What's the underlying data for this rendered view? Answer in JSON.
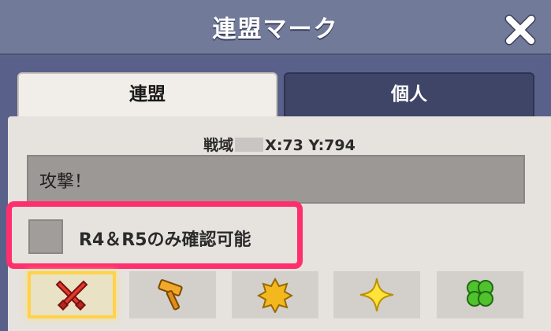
{
  "header": {
    "title": "連盟マーク",
    "close_icon": "close-x-icon"
  },
  "tabs": [
    {
      "label": "連盟",
      "active": true
    },
    {
      "label": "個人",
      "active": false
    }
  ],
  "location": {
    "prefix": "戦域",
    "coords": "X:73  Y:794"
  },
  "message": {
    "value": "攻撃！"
  },
  "restrict": {
    "label": "R4＆R5のみ確認可能",
    "checked": false
  },
  "markers": [
    {
      "icon": "crossed-swords-icon",
      "selected": true
    },
    {
      "icon": "hammer-icon",
      "selected": false
    },
    {
      "icon": "gold-badge-icon",
      "selected": false
    },
    {
      "icon": "star-icon",
      "selected": false
    },
    {
      "icon": "clover-icon",
      "selected": false
    }
  ],
  "colors": {
    "highlight": "#ff2f6e",
    "header": "#727a99",
    "panel": "#e6e2dd"
  }
}
